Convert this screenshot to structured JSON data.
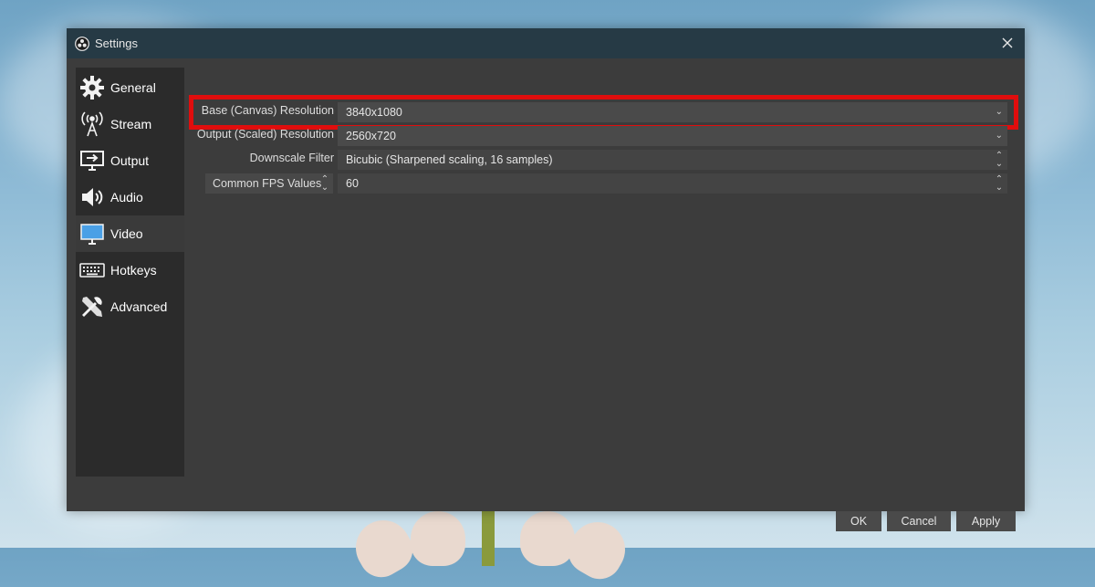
{
  "window": {
    "title": "Settings",
    "close_icon": "close-icon"
  },
  "sidebar": {
    "items": [
      {
        "label": "General",
        "icon": "gear-icon"
      },
      {
        "label": "Stream",
        "icon": "broadcast-icon"
      },
      {
        "label": "Output",
        "icon": "monitor-output-icon"
      },
      {
        "label": "Audio",
        "icon": "speaker-icon"
      },
      {
        "label": "Video",
        "icon": "monitor-icon",
        "active": true
      },
      {
        "label": "Hotkeys",
        "icon": "keyboard-icon"
      },
      {
        "label": "Advanced",
        "icon": "tools-icon"
      }
    ]
  },
  "video": {
    "base_resolution": {
      "label": "Base (Canvas) Resolution",
      "value": "3840x1080"
    },
    "output_resolution": {
      "label": "Output (Scaled) Resolution",
      "value": "2560x720"
    },
    "downscale_filter": {
      "label": "Downscale Filter",
      "value": "Bicubic (Sharpened scaling, 16 samples)"
    },
    "fps": {
      "type_label": "Common FPS Values",
      "value": "60"
    }
  },
  "buttons": {
    "ok": "OK",
    "cancel": "Cancel",
    "apply": "Apply"
  },
  "colors": {
    "highlight": "#e00d0d",
    "titlebar": "#263a45",
    "panel": "#3c3c3c"
  }
}
